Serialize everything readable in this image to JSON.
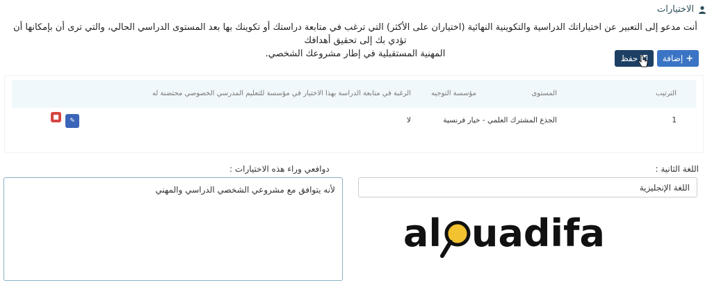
{
  "header": {
    "title": "الاختيارات",
    "icon": "user-icon"
  },
  "intro": {
    "line1": "أنت مدعو إلى التعبير عن اختياراتك الدراسية والتكوينية النهائية (اختياران على الأكثر) التي ترغب في متابعة دراستك أو تكوينك بها بعد المستوى الدراسي الحالي، والتي ترى أن بإمكانها أن تؤدي بك إلى تحقيق أهدافك",
    "line2": "المهنية المستقبلية في إطار مشروعك الشخصي."
  },
  "toolbar": {
    "add_label": "إضافة",
    "save_label": "حفظ"
  },
  "table": {
    "headers": [
      "الترتيب",
      "المستوى",
      "مؤسسة التوجيه",
      "الرغبة في متابعة الدراسة بهذا الاختيار في مؤسسة للتعليم المدرسي الخصوصي محتضنة له"
    ],
    "rows": [
      {
        "rank": "1",
        "level": "الجذع المشترك العلمي - خيار فرنسية",
        "institution": "",
        "private_wish": "لا"
      }
    ]
  },
  "form": {
    "second_language_label": "اللغة الثانية :",
    "second_language_value": "اللغة الإنجليزية",
    "motivations_label": "دوافعي وراء هذه الاختيارات :",
    "motivations_value": "لأنه يتوافق مع مشروعي الشخصي الدراسي والمهني"
  },
  "logo": {
    "text": "alouadifa"
  },
  "colors": {
    "primary": "#3a74c4",
    "save": "#1d3f63",
    "delete": "#d64540",
    "header_bg": "#f1f8fb"
  }
}
